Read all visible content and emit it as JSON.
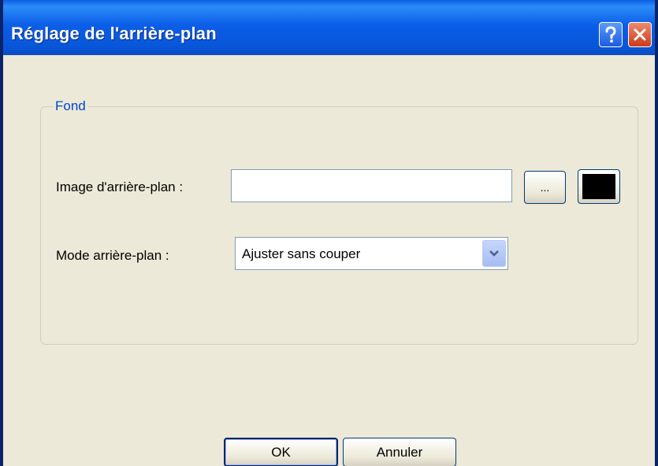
{
  "window": {
    "title": "Réglage de l'arrière-plan",
    "help_label": "?",
    "close_label": "×"
  },
  "group": {
    "legend": "Fond"
  },
  "image_field": {
    "label": "Image d'arrière-plan :",
    "value": "",
    "browse_label": "...",
    "color_value": "#000000"
  },
  "mode_field": {
    "label": "Mode arrière-plan :",
    "selected": "Ajuster sans couper"
  },
  "buttons": {
    "ok": "OK",
    "cancel": "Annuler"
  },
  "colors": {
    "titlebar": "#0a5ee6",
    "legend_text": "#0046d5",
    "dialog_bg": "#ece9d8"
  }
}
